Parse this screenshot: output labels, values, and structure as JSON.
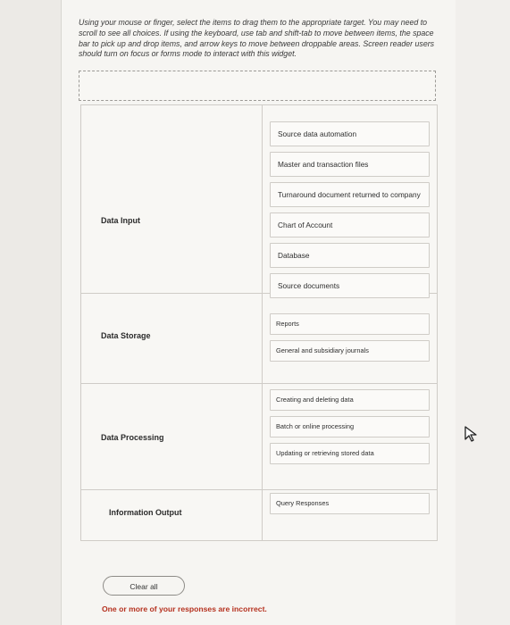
{
  "instructions": "Using your mouse or finger, select the items to drag them to the appropriate target. You may need to scroll to see all choices. If using the keyboard, use tab and shift-tab to move between items, the space bar to pick up and drop items, and arrow keys to move between droppable areas. Screen reader users should turn on focus or forms mode to interact with this widget.",
  "rows": [
    {
      "label": "Data Input",
      "items": [
        "Source data automation",
        "Master and transaction files",
        "Turnaround document returned to company",
        "Chart of Account",
        "Database",
        "Source documents"
      ]
    },
    {
      "label": "Data Storage",
      "items": [
        "Reports",
        "General and subsidiary journals"
      ]
    },
    {
      "label": "Data Processing",
      "items": [
        "Creating and deleting data",
        "Batch or online processing",
        "Updating or retrieving stored data"
      ]
    },
    {
      "label": "Information Output",
      "items": [
        "Query Responses"
      ]
    }
  ],
  "clear_label": "Clear all",
  "feedback": "One or more of your responses are incorrect."
}
